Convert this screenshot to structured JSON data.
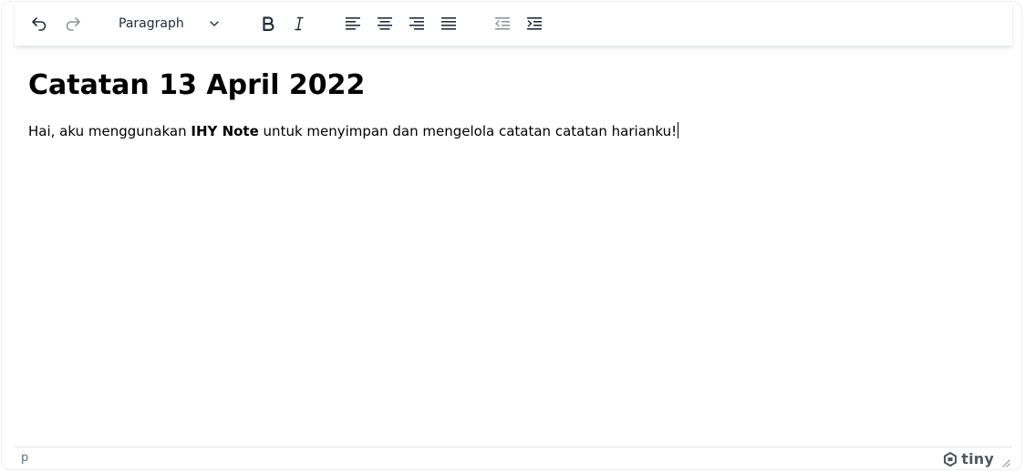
{
  "toolbar": {
    "undo_icon": "undo-icon",
    "redo_icon": "redo-icon",
    "block_format": "Paragraph",
    "dropdown_icon": "chevron-down-icon",
    "bold_icon": "bold-icon",
    "italic_icon": "italic-icon",
    "align_left_icon": "align-left-icon",
    "align_center_icon": "align-center-icon",
    "align_right_icon": "align-right-icon",
    "justify_icon": "align-justify-icon",
    "outdent_icon": "outdent-icon",
    "indent_icon": "indent-icon"
  },
  "document": {
    "heading": "Catatan 13 April 2022",
    "paragraph_before": "Hai, aku menggunakan ",
    "paragraph_bold": "IHY Note",
    "paragraph_after": " untuk menyimpan dan mengelola catatan catatan harianku!"
  },
  "statusbar": {
    "element_path": "p",
    "branding": "tiny",
    "branding_icon": "tiny-logo-icon",
    "resize_icon": "resize-handle-icon"
  },
  "colors": {
    "icon": "#222f3e",
    "icon_disabled": "#8a9099",
    "border": "#eeeeee",
    "text": "#000000"
  }
}
